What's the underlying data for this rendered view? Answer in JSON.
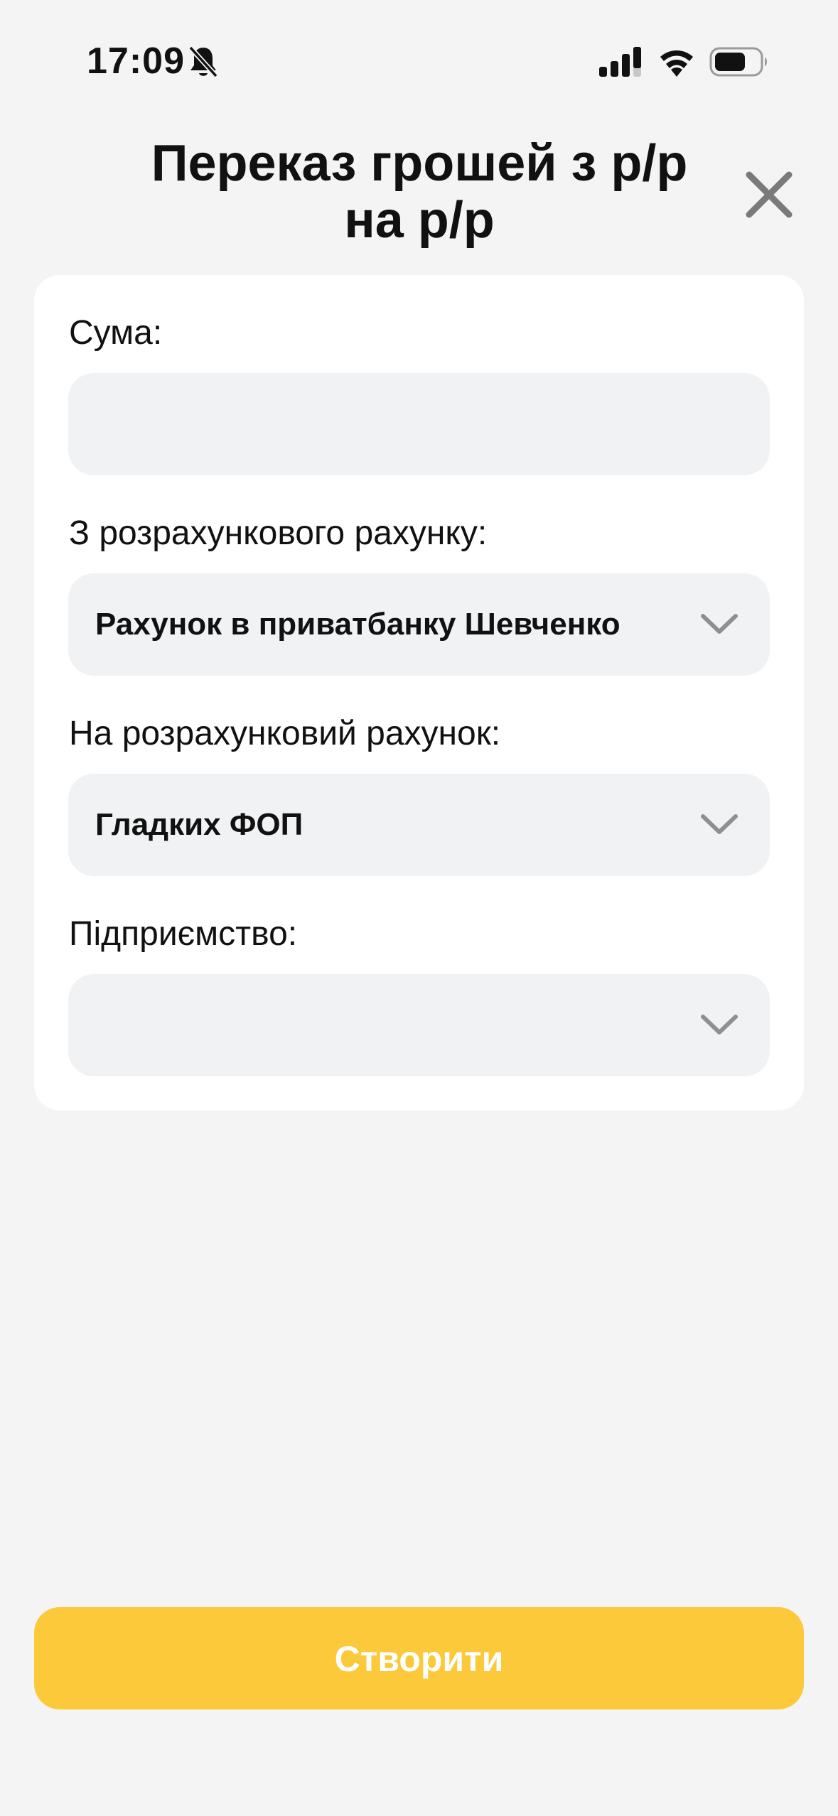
{
  "status_bar": {
    "time": "17:09",
    "icons": [
      "bell-off-icon",
      "signal-icon",
      "wifi-icon",
      "battery-icon"
    ]
  },
  "header": {
    "title": "Переказ грошей з р/р на р/р",
    "close_icon": "close-icon"
  },
  "form": {
    "amount": {
      "label": "Сума:",
      "value": "",
      "placeholder": ""
    },
    "from_account": {
      "label": "З розрахункового рахунку:",
      "selected": "Рахунок в приватбанку Шевченко"
    },
    "to_account": {
      "label": "На розрахунковий рахунок:",
      "selected": "Гладких ФОП"
    },
    "enterprise": {
      "label": "Підприємство:",
      "selected": ""
    }
  },
  "actions": {
    "create_label": "Створити"
  },
  "colors": {
    "background": "#f4f4f4",
    "card": "#ffffff",
    "field": "#f1f2f4",
    "accent": "#fbc93a",
    "icon_gray": "#7a7a7a",
    "chevron_gray": "#8e8e93"
  }
}
